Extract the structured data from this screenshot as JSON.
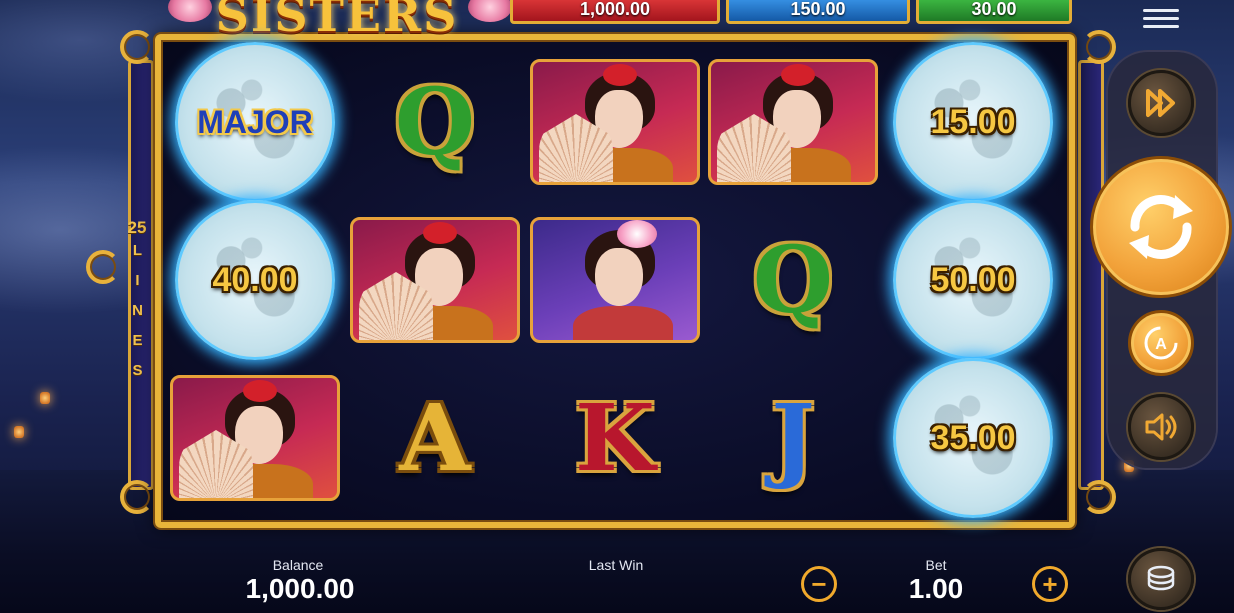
{
  "game": {
    "title": "SISTERS",
    "lines_count": "25",
    "lines_word": "L I N E S"
  },
  "jackpots": [
    {
      "value": "1,000.00",
      "color": "#c8232a"
    },
    {
      "value": "150.00",
      "color": "#1d7bd4"
    },
    {
      "value": "30.00",
      "color": "#2ea437"
    }
  ],
  "reels": {
    "row1": [
      "MAJOR",
      "Q",
      "geisha",
      "geisha",
      "15.00"
    ],
    "row2": [
      "40.00",
      "geisha",
      "lotus",
      "Q",
      "50.00"
    ],
    "row3": [
      "geisha",
      "A",
      "K",
      "J",
      "35.00"
    ]
  },
  "moon_values": {
    "r1c1": "MAJOR",
    "r1c5": "15.00",
    "r2c1": "40.00",
    "r2c5": "50.00",
    "r3c5": "35.00"
  },
  "letters": {
    "r1c2": "Q",
    "r2c4": "Q",
    "r3c2": "A",
    "r3c3": "K",
    "r3c4": "J"
  },
  "bottom_bar": {
    "balance_label": "Balance",
    "balance_value": "1,000.00",
    "last_win_label": "Last Win",
    "last_win_value": "",
    "bet_label": "Bet",
    "bet_value": "1.00",
    "minus_symbol": "−",
    "plus_symbol": "+"
  },
  "controls": {
    "turbo": "fast-forward-icon",
    "spin": "spin-icon",
    "autoplay": "autoplay-icon",
    "sound": "speaker-icon",
    "menu": "hamburger-menu-icon",
    "coins": "coin-stack-icon"
  },
  "colors": {
    "frame_gold": "#e9b53a",
    "orange_button": "#f2a23a",
    "moon_glow": "#37b4ff"
  }
}
